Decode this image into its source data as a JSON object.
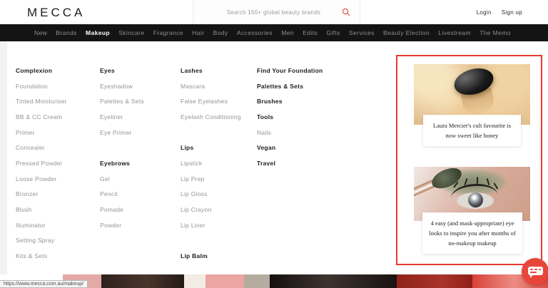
{
  "accent": {
    "red": "#e8453b",
    "annotation_red": "#e53a2e",
    "nav_bg": "#141414"
  },
  "header": {
    "logo": "MECCA",
    "search": {
      "placeholder": "Search 150+ global beauty brands",
      "icon": "search-icon"
    },
    "login_label": "Login",
    "signup_label": "Sign up"
  },
  "nav": {
    "items": [
      {
        "label": "New"
      },
      {
        "label": "Brands"
      },
      {
        "label": "Makeup",
        "active": true
      },
      {
        "label": "Skincare"
      },
      {
        "label": "Fragrance"
      },
      {
        "label": "Hair"
      },
      {
        "label": "Body"
      },
      {
        "label": "Accessories"
      },
      {
        "label": "Men"
      },
      {
        "label": "Edits"
      },
      {
        "label": "Gifts"
      },
      {
        "label": "Services"
      },
      {
        "label": "Beauty Election"
      },
      {
        "label": "Livestream"
      },
      {
        "label": "The Memo"
      }
    ]
  },
  "mega_menu": {
    "columns": [
      {
        "items": [
          {
            "label": "Complexion",
            "bold": true
          },
          {
            "label": "Foundation"
          },
          {
            "label": "Tinted Moisturiser"
          },
          {
            "label": "BB & CC Cream"
          },
          {
            "label": "Primer"
          },
          {
            "label": "Concealer"
          },
          {
            "label": "Pressed Powder"
          },
          {
            "label": "Loose Powder"
          },
          {
            "label": "Bronzer"
          },
          {
            "label": "Blush"
          },
          {
            "label": "Illuminator"
          },
          {
            "label": "Setting Spray"
          },
          {
            "label": "Kits & Sets"
          }
        ]
      },
      {
        "items": [
          {
            "label": "Eyes",
            "bold": true
          },
          {
            "label": "Eyeshadow"
          },
          {
            "label": "Palettes & Sets"
          },
          {
            "label": "Eyeliner"
          },
          {
            "label": "Eye Primer"
          },
          {
            "spacer": true
          },
          {
            "label": "Eyebrows",
            "bold": true
          },
          {
            "label": "Gel"
          },
          {
            "label": "Pencil"
          },
          {
            "label": "Pomade"
          },
          {
            "label": "Powder"
          }
        ]
      },
      {
        "items": [
          {
            "label": "Lashes",
            "bold": true
          },
          {
            "label": "Mascara"
          },
          {
            "label": "False Eyelashes"
          },
          {
            "label": "Eyelash Conditioning"
          },
          {
            "spacer": true
          },
          {
            "label": "Lips",
            "bold": true
          },
          {
            "label": "Lipstick"
          },
          {
            "label": "Lip Prep"
          },
          {
            "label": "Lip Gloss"
          },
          {
            "label": "Lip Crayon"
          },
          {
            "label": "Lip Liner"
          },
          {
            "spacer": true
          },
          {
            "label": "Lip Balm",
            "bold": true
          }
        ]
      },
      {
        "items": [
          {
            "label": "Find Your Foundation",
            "bold": true
          },
          {
            "label": "Palettes & Sets",
            "bold": true
          },
          {
            "label": "Brushes",
            "bold": true
          },
          {
            "label": "Tools",
            "bold": true
          },
          {
            "label": "Nails"
          },
          {
            "label": "Vegan",
            "bold": true
          },
          {
            "label": "Travel",
            "bold": true
          }
        ]
      }
    ],
    "promos": [
      {
        "title": "Laura Mercier's cult favourite is now sweet like honey",
        "image": "powder-pot-image"
      },
      {
        "title": "4 easy (and mask-appropriate) eye looks to inspire you after months of no-makeup makeup",
        "image": "eye-shadow-look-image"
      }
    ]
  },
  "chat": {
    "icon": "chat-bubble-icon"
  },
  "status_bar": {
    "url": "https://www.mecca.com.au/makeup/"
  }
}
